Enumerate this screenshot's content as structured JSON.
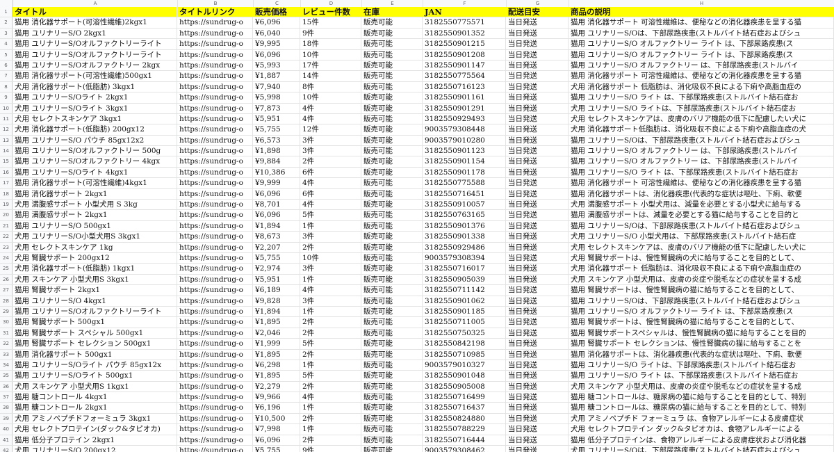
{
  "columns": [
    "A",
    "B",
    "C",
    "D",
    "E",
    "F",
    "G",
    "H"
  ],
  "header": [
    "タイトル",
    "タイトルリンク",
    "販売価格",
    "レビュー件数",
    "在庫",
    "JAN",
    "配送目安",
    "商品の説明"
  ],
  "rows": [
    [
      "猫用 消化器サポート(可溶性繊維)2kgx1",
      "https://sundrug-o",
      "¥6,096",
      "15件",
      "販売可能",
      "3182550775571",
      "当日発送",
      "猫用 消化器サポート 可溶性繊維は、便秘などの消化器疾患を呈する猫"
    ],
    [
      "猫用 ユリナリーS/O 2kgx1",
      "https://sundrug-o",
      "¥6,040",
      "9件",
      "販売可能",
      "3182550901352",
      "当日発送",
      "猫用 ユリナリーS/Oは、下部尿路疾患(ストルバイト結石症およびシュ"
    ],
    [
      "猫用 ユリナリーS/Oオルファクトリーライト",
      "https://sundrug-o",
      "¥9,995",
      "18件",
      "販売可能",
      "3182550901215",
      "当日発送",
      "猫用 ユリナリーS/O オルファクトリー ライト は、下部尿路疾患(ス"
    ],
    [
      "猫用 ユリナリーS/Oオルファクトリーライト",
      "https://sundrug-o",
      "¥6,096",
      "10件",
      "販売可能",
      "3182550901208",
      "当日発送",
      "猫用 ユリナリーS/O オルファクトリー ライト は、下部尿路疾患(ス"
    ],
    [
      "猫用 ユリナリーS/Oオルファクトリー 2kgx",
      "https://sundrug-o",
      "¥5,993",
      "17件",
      "販売可能",
      "3182550901147",
      "当日発送",
      "猫用 ユリナリーS/O オルファクトリー は、下部尿路疾患(ストルバイ"
    ],
    [
      "猫用 消化器サポート(可溶性繊維)500gx1",
      "https://sundrug-o",
      "¥1,887",
      "14件",
      "販売可能",
      "3182550775564",
      "当日発送",
      "猫用 消化器サポート 可溶性繊維は、便秘などの消化器疾患を呈する猫"
    ],
    [
      "犬用 消化器サポート(低脂肪) 3kgx1",
      "https://sundrug-o",
      "¥7,940",
      "8件",
      "販売可能",
      "3182550716123",
      "当日発送",
      "犬用 消化器サポート 低脂肪は、消化吸収不良による下痢や高脂血症の"
    ],
    [
      "猫用 ユリナリーS/Oライト 2kgx1",
      "https://sundrug-o",
      "¥5,998",
      "10件",
      "販売可能",
      "3182550901161",
      "当日発送",
      "猫用 ユリナリーS/O ライト は、下部尿路疾患(ストルバイト結石症お"
    ],
    [
      "犬用 ユリナリーS/Oライト 3kgx1",
      "https://sundrug-o",
      "¥7,873",
      "4件",
      "販売可能",
      "3182550901291",
      "当日発送",
      "犬用 ユリナリーS/O ライトは、下部尿路疾患(ストルバイト結石症お"
    ],
    [
      "犬用 セレクトスキンケア 3kgx1",
      "https://sundrug-o",
      "¥5,951",
      "4件",
      "販売可能",
      "3182550929493",
      "当日発送",
      "犬用 セレクトスキンケアは、皮膚のバリア機能の低下に配慮したい犬に"
    ],
    [
      "犬用 消化器サポート(低脂肪) 200gx12",
      "https://sundrug-o",
      "¥5,755",
      "12件",
      "販売可能",
      "9003579308448",
      "当日発送",
      "犬用 消化器サポート低脂肪は、消化吸収不良による下痢や高脂血症の犬"
    ],
    [
      "猫用 ユリナリーS/O パウチ 85gx12x2",
      "https://sundrug-o",
      "¥6,573",
      "3件",
      "販売可能",
      "9003579010280",
      "当日発送",
      "猫用 ユリナリーS/Oは、下部尿路疾患(ストルバイト結石症およびシュ"
    ],
    [
      "猫用 ユリナリーS/Oオルファクトリー 500g",
      "https://sundrug-o",
      "¥1,898",
      "3件",
      "販売可能",
      "3182550901123",
      "当日発送",
      "猫用 ユリナリーS/O オルファクトリー は、下部尿路疾患(ストルバイ"
    ],
    [
      "猫用 ユリナリーS/Oオルファクトリー 4kgx",
      "https://sundrug-o",
      "¥9,884",
      "2件",
      "販売可能",
      "3182550901154",
      "当日発送",
      "猫用 ユリナリーS/O オルファクトリー は、下部尿路疾患(ストルバイ"
    ],
    [
      "猫用 ユリナリーS/Oライト 4kgx1",
      "https://sundrug-o",
      "¥10,386",
      "6件",
      "販売可能",
      "3182550901178",
      "当日発送",
      "猫用 ユリナリーS/O ライト は、下部尿路疾患(ストルバイト結石症お"
    ],
    [
      "猫用 消化器サポート(可溶性繊維)4kgx1",
      "https://sundrug-o",
      "¥9,999",
      "4件",
      "販売可能",
      "3182550775588",
      "当日発送",
      "猫用 消化器サポート 可溶性繊維は、便秘などの消化器疾患を呈する猫"
    ],
    [
      "猫用 消化器サポート 2kgx1",
      "https://sundrug-o",
      "¥6,096",
      "6件",
      "販売可能",
      "3182550716451",
      "当日発送",
      "猫用 消化器サポートは、消化器疾患(代表的な症状は嘔吐、下痢、軟便"
    ],
    [
      "犬用 満腹感サポート 小型犬用 S 3kg",
      "https://sundrug-o",
      "¥8,701",
      "4件",
      "販売可能",
      "3182550910057",
      "当日発送",
      "犬用 満腹感サポート 小型犬用は、減量を必要とする小型犬に給与する"
    ],
    [
      "猫用 満腹感サポート 2kgx1",
      "https://sundrug-o",
      "¥6,096",
      "5件",
      "販売可能",
      "3182550763165",
      "当日発送",
      "猫用 満腹感サポートは、減量を必要とする猫に給与することを目的と"
    ],
    [
      "猫用 ユリナリーS/O 500gx1",
      "https://sundrug-o",
      "¥1,894",
      "1件",
      "販売可能",
      "3182550901376",
      "当日発送",
      "猫用 ユリナリーS/Oは、下部尿路疾患(ストルバイト結石症およびシュ"
    ],
    [
      "犬用 ユリナリーS/O小型犬用S 3kgx1",
      "https://sundrug-o",
      "¥8,673",
      "3件",
      "販売可能",
      "3182550901338",
      "当日発送",
      "犬用 ユリナリーS/O 小型犬用は、下部尿路疾患(ストルバイト結石症"
    ],
    [
      "犬用 セレクトスキンケア 1kg",
      "https://sundrug-o",
      "¥2,207",
      "2件",
      "販売可能",
      "3182550929486",
      "当日発送",
      "犬用 セレクトスキンケアは、皮膚のバリア機能の低下に配慮したい犬に"
    ],
    [
      "犬用 腎臓サポート 200gx12",
      "https://sundrug-o",
      "¥5,755",
      "10件",
      "販売可能",
      "9003579308394",
      "当日発送",
      "犬用 腎臓サポートは、慢性腎臓病の犬に給与することを目的として、"
    ],
    [
      "犬用 消化器サポート(低脂肪) 1kgx1",
      "https://sundrug-o",
      "¥2,974",
      "3件",
      "販売可能",
      "3182550716017",
      "当日発送",
      "犬用 消化器サポート 低脂肪は、消化吸収不良による下痢や高脂血症の"
    ],
    [
      "犬用 スキンケア 小型犬用S 3kgx1",
      "https://sundrug-o",
      "¥5,951",
      "1件",
      "販売可能",
      "3182550905039",
      "当日発送",
      "犬用 スキンケア 小型犬用は、皮膚の炎症や脱毛などの症状を呈する成"
    ],
    [
      "猫用 腎臓サポート 2kgx1",
      "https://sundrug-o",
      "¥6,189",
      "4件",
      "販売可能",
      "3182550711142",
      "当日発送",
      "猫用 腎臓サポートは、慢性腎臓病の猫に給与することを目的として、"
    ],
    [
      "猫用 ユリナリーS/O 4kgx1",
      "https://sundrug-o",
      "¥9,828",
      "3件",
      "販売可能",
      "3182550901062",
      "当日発送",
      "猫用 ユリナリーS/Oは、下部尿路疾患(ストルバイト結石症およびシュ"
    ],
    [
      "猫用 ユリナリーS/Oオルファクトリーライト",
      "https://sundrug-o",
      "¥1,894",
      "1件",
      "販売可能",
      "3182550901185",
      "当日発送",
      "猫用 ユリナリーS/O オルファクトリー ライト は、下部尿路疾患(ス"
    ],
    [
      "猫用 腎臓サポート 500gx1",
      "https://sundrug-o",
      "¥1,895",
      "2件",
      "販売可能",
      "3182550711005",
      "当日発送",
      "猫用 腎臓サポートは、慢性腎臓病の猫に給与することを目的として、"
    ],
    [
      "猫用 腎臓サポート スペシャル 500gx1",
      "https://sundrug-o",
      "¥2,046",
      "2件",
      "販売可能",
      "3182550750325",
      "当日発送",
      "猫用 腎臓サポートスペシャルは、慢性腎臓病の猫に給与することを目的"
    ],
    [
      "猫用 腎臓サポート セレクション 500gx1",
      "https://sundrug-o",
      "¥1,999",
      "5件",
      "販売可能",
      "3182550842198",
      "当日発送",
      "猫用 腎臓サポート セレクションは、慢性腎臓病の猫に給与することを"
    ],
    [
      "猫用 消化器サポート 500gx1",
      "https://sundrug-o",
      "¥1,895",
      "2件",
      "販売可能",
      "3182550710985",
      "当日発送",
      "猫用 消化器サポートは、消化器疾患(代表的な症状は嘔吐、下痢、軟便"
    ],
    [
      "猫用 ユリナリーS/Oライト パウチ 85gx12x",
      "https://sundrug-o",
      "¥6,298",
      "1件",
      "販売可能",
      "9003579010327",
      "当日発送",
      "猫用 ユリナリーS/O ライトは、下部尿路疾患(ストルバイト結石症お"
    ],
    [
      "猫用 ユリナリーS/Oライト 500gx1",
      "https://sundrug-o",
      "¥1,895",
      "5件",
      "販売可能",
      "3182550901048",
      "当日発送",
      "猫用 ユリナリーS/O ライト は、下部尿路疾患(ストルバイト結石症お"
    ],
    [
      "犬用 スキンケア 小型犬用S 1kgx1",
      "https://sundrug-o",
      "¥2,279",
      "2件",
      "販売可能",
      "3182550905008",
      "当日発送",
      "犬用 スキンケア 小型犬用は、皮膚の炎症や脱毛などの症状を呈する成"
    ],
    [
      "猫用 糖コントロール 4kgx1",
      "https://sundrug-o",
      "¥9,966",
      "4件",
      "販売可能",
      "3182550716499",
      "当日発送",
      "猫用 糖コントロールは、糖尿病の猫に給与することを目的として、特別"
    ],
    [
      "猫用 糖コントロール 2kgx1",
      "https://sundrug-o",
      "¥6,196",
      "1件",
      "販売可能",
      "3182550716437",
      "当日発送",
      "猫用 糖コントロールは、糖尿病の猫に給与することを目的として、特別"
    ],
    [
      "犬用 アミノペプチドフォーミュラ 3kgx1",
      "https://sundrug-o",
      "¥10,500",
      "2件",
      "販売可能",
      "3182550824880",
      "当日発送",
      "犬用 アミノペプチド フォーミュラ は、食物アレルギーによる皮膚症状"
    ],
    [
      "犬用 セレクトプロテイン(ダック&タピオカ)",
      "https://sundrug-o",
      "¥7,998",
      "1件",
      "販売可能",
      "3182550788229",
      "当日発送",
      "犬用 セレクトプロテイン ダック&タピオカは、食物アレルギーによる"
    ],
    [
      "猫用 低分子プロテイン 2kgx1",
      "https://sundrug-o",
      "¥6,096",
      "2件",
      "販売可能",
      "3182550716444",
      "当日発送",
      "猫用 低分子プロテインは、食物アレルギーによる皮膚症状および消化器"
    ],
    [
      "犬用 ユリナリーS/O 200gx12",
      "https://sundrug-o",
      "¥5,755",
      "9件",
      "販売可能",
      "9003579308462",
      "当日発送",
      "犬用 ユリナリーS/Oは、下部尿路疾患(ストルバイト結石症およびシュ"
    ]
  ]
}
